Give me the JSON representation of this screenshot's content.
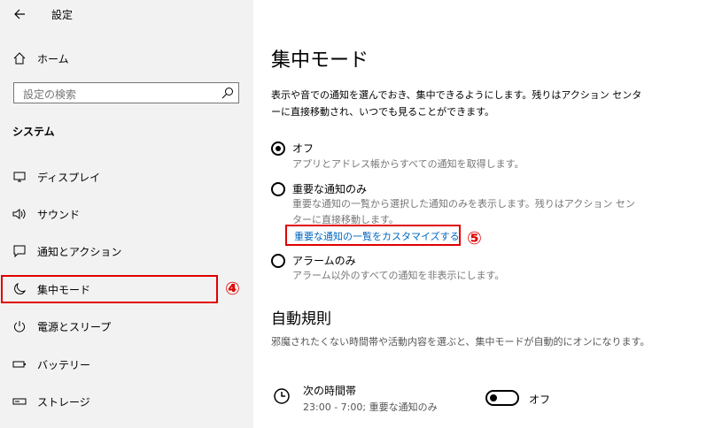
{
  "window": {
    "title": "設定"
  },
  "sidebar": {
    "home": "ホーム",
    "search_placeholder": "設定の検索",
    "section": "システム",
    "items": [
      {
        "label": "ディスプレイ",
        "icon": "display-icon"
      },
      {
        "label": "サウンド",
        "icon": "speaker-icon"
      },
      {
        "label": "通知とアクション",
        "icon": "notification-icon"
      },
      {
        "label": "集中モード",
        "icon": "moon-icon"
      },
      {
        "label": "電源とスリープ",
        "icon": "power-icon"
      },
      {
        "label": "バッテリー",
        "icon": "battery-icon"
      },
      {
        "label": "ストレージ",
        "icon": "storage-icon"
      }
    ]
  },
  "annotations": {
    "badge4": "④",
    "badge5": "⑤",
    "color": "#e00000"
  },
  "main": {
    "title": "集中モード",
    "description": "表示や音での通知を選んでおき、集中できるようにします。残りはアクション センターに直接移動され、いつでも見ることができます。",
    "options": [
      {
        "label": "オフ",
        "desc": "アプリとアドレス帳からすべての通知を取得します。",
        "selected": true
      },
      {
        "label": "重要な通知のみ",
        "desc": "重要な通知の一覧から選択した通知のみを表示します。残りはアクション センターに直接移動します。",
        "selected": false
      },
      {
        "label": "アラームのみ",
        "desc": "アラーム以外のすべての通知を非表示にします。",
        "selected": false
      }
    ],
    "customize_link": "重要な通知の一覧をカスタマイズする",
    "rules_title": "自動規則",
    "rules_desc": "邪魔されたくない時間帯や活動内容を選ぶと、集中モードが自動的にオンになります。",
    "rule": {
      "title": "次の時間帯",
      "subtitle": "23:00 - 7:00; 重要な通知のみ",
      "toggle_label": "オフ"
    },
    "link_color": "#0067c0"
  }
}
